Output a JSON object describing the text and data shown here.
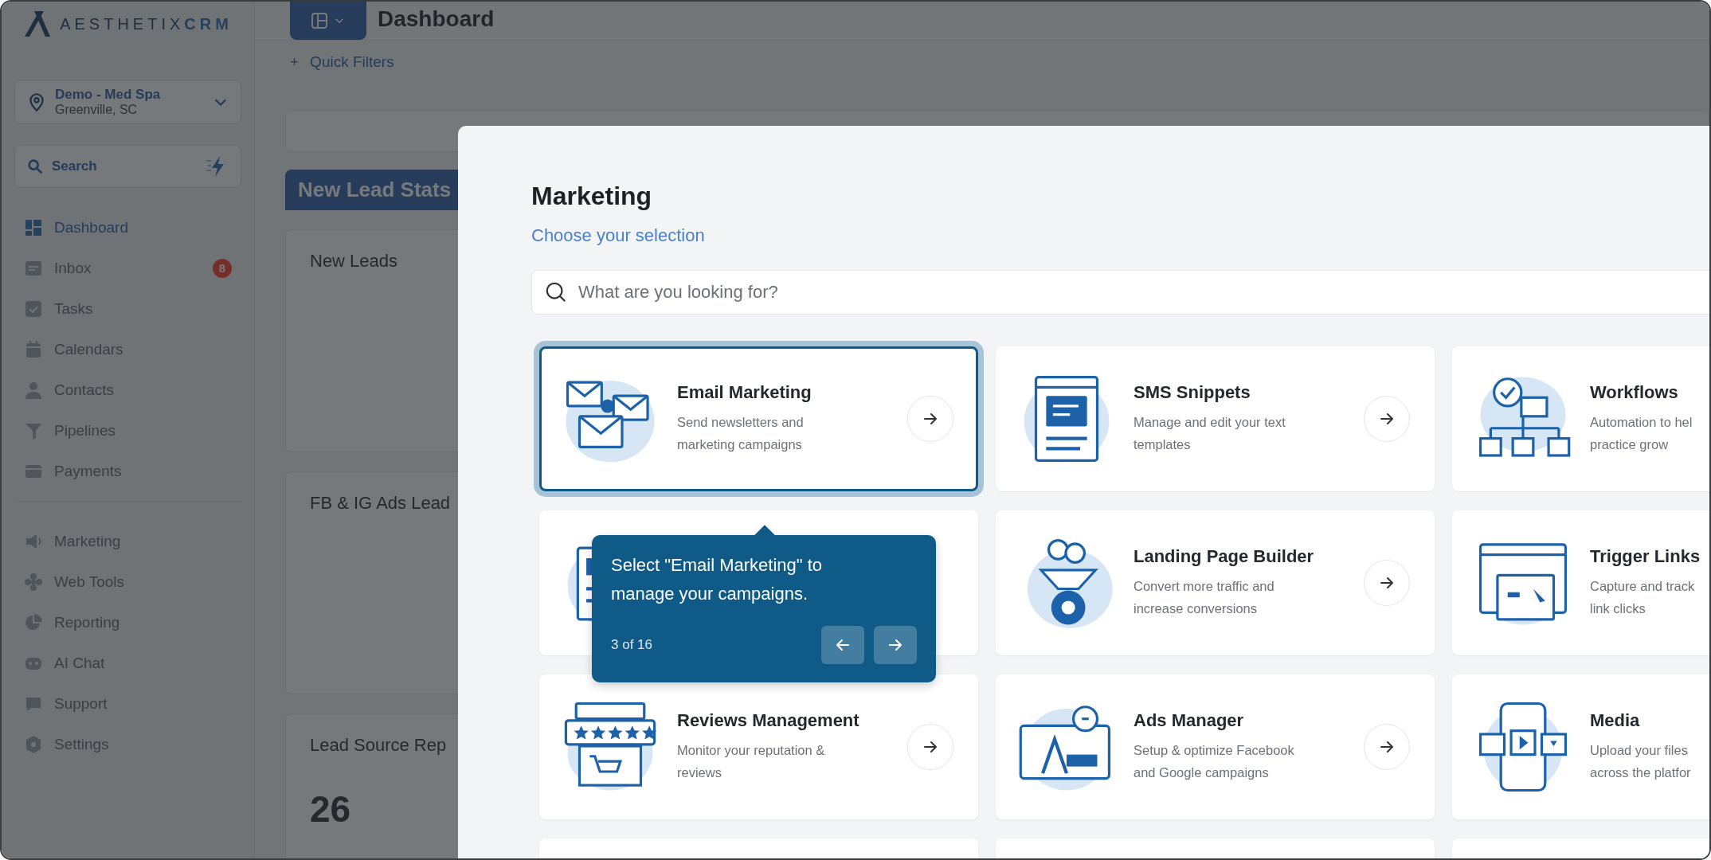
{
  "sidebar": {
    "logo": {
      "name": "AESTHETIX",
      "suffix": "CRM"
    },
    "location": {
      "name": "Demo - Med Spa",
      "address": "Greenville, SC"
    },
    "search": {
      "label": "Search"
    },
    "nav_groups": [
      [
        {
          "label": "Dashboard",
          "selected": true
        },
        {
          "label": "Inbox",
          "selected": false,
          "badge": "8"
        },
        {
          "label": "Tasks",
          "selected": false
        },
        {
          "label": "Calendars",
          "selected": false
        },
        {
          "label": "Contacts",
          "selected": false
        },
        {
          "label": "Pipelines",
          "selected": false
        },
        {
          "label": "Payments",
          "selected": false
        }
      ],
      [
        {
          "label": "Marketing",
          "selected": false
        },
        {
          "label": "Web Tools",
          "selected": false
        },
        {
          "label": "Reporting",
          "selected": false
        },
        {
          "label": "AI Chat",
          "selected": false
        },
        {
          "label": "Support",
          "selected": false
        },
        {
          "label": "Settings",
          "selected": false
        }
      ]
    ]
  },
  "header": {
    "title": "Dashboard"
  },
  "quick_filters": {
    "icon": "+",
    "label": "Quick Filters"
  },
  "dashboard": {
    "section_tab": "New Lead Stats",
    "cards": [
      {
        "title": "New Leads"
      },
      {
        "title": "FB & IG Ads Lead"
      },
      {
        "title": "Lead Source Rep",
        "value": "26"
      }
    ]
  },
  "modal": {
    "title": "Marketing",
    "subtitle": "Choose your selection",
    "search": {
      "placeholder": "What are you looking for?"
    },
    "cards": [
      {
        "title": "Email Marketing",
        "description": [
          "Send newsletters and",
          "marketing campaigns"
        ],
        "selected": true,
        "arrow": true
      },
      {
        "title": "SMS Snippets",
        "description": [
          "Manage and edit your text",
          "templates"
        ],
        "selected": false,
        "arrow": true
      },
      {
        "title": "Workflows",
        "description": [
          "Automation to hel",
          "practice grow"
        ],
        "selected": false,
        "arrow": false
      },
      {
        "selected": false,
        "arrow": false
      },
      {
        "title": "Landing Page Builder",
        "description": [
          "Convert more traffic and",
          "increase conversions"
        ],
        "selected": false,
        "arrow": true
      },
      {
        "title": "Trigger Links",
        "description": [
          "Capture and track",
          "link clicks"
        ],
        "selected": false,
        "arrow": false
      },
      {
        "title": "Reviews Management",
        "description": [
          "Monitor your reputation &",
          "reviews"
        ],
        "selected": false,
        "arrow": true
      },
      {
        "title": "Ads Manager",
        "description": [
          "Setup & optimize Facebook",
          "and Google campaigns"
        ],
        "selected": false,
        "arrow": true
      },
      {
        "title": "Media",
        "description": [
          "Upload your files",
          "across the platfor"
        ],
        "selected": false,
        "arrow": false
      },
      {
        "selected": false,
        "arrow": false
      },
      {
        "selected": false,
        "arrow": false
      },
      {
        "selected": false,
        "arrow": false
      }
    ]
  },
  "tour": {
    "text": "Select \"Email Marketing\" to manage your campaigns.",
    "step": "3 of 16"
  }
}
